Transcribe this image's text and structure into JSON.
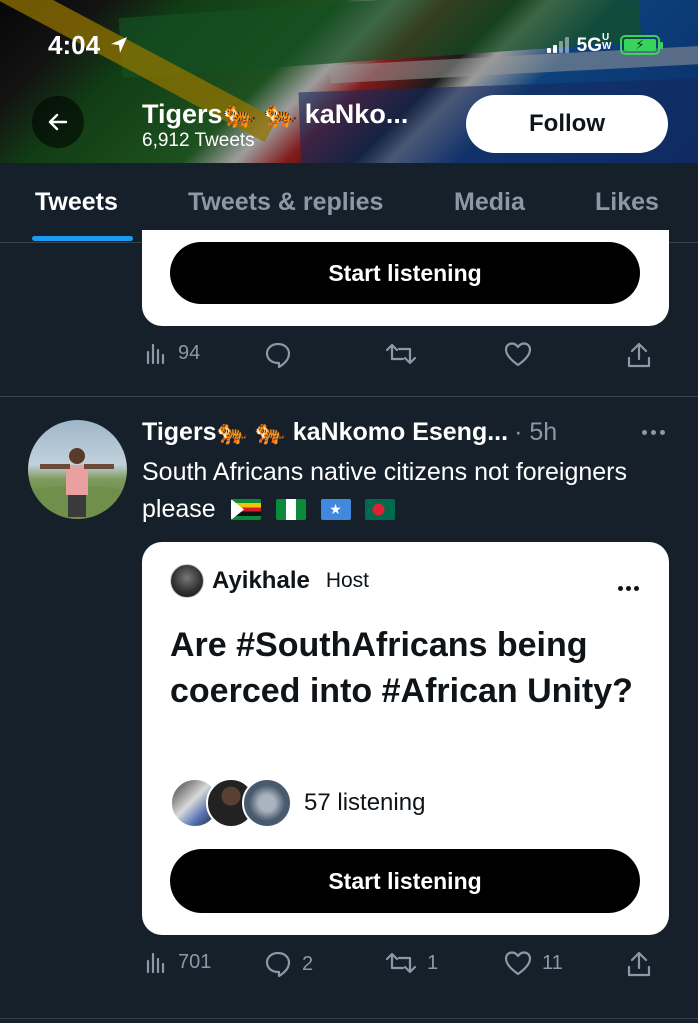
{
  "status_bar": {
    "time": "4:04",
    "network": "5G",
    "network_suffix": "UW"
  },
  "header": {
    "display_name": "Tigers🐅 🐅 kaNko...",
    "tweet_count": "6,912 Tweets",
    "follow_label": "Follow"
  },
  "tabs": [
    {
      "label": "Tweets",
      "active": true
    },
    {
      "label": "Tweets & replies",
      "active": false
    },
    {
      "label": "Media",
      "active": false
    },
    {
      "label": "Likes",
      "active": false
    }
  ],
  "tweet1": {
    "start_listening_label": "Start listening",
    "views": "94",
    "replies": "",
    "retweets": "",
    "likes": ""
  },
  "tweet2": {
    "author": "Tigers🐅 🐅 kaNkomo Eseng...",
    "time": "· 5h",
    "text": "South Africans native citizens not foreigners please",
    "flags": [
      "zimbabwe-flag",
      "nigeria-flag",
      "somalia-flag",
      "bangladesh-flag"
    ],
    "space": {
      "host_name": "Ayikhale",
      "host_tag": "Host",
      "title": "Are #SouthAfricans being coerced into #African Unity?",
      "listening": "57 listening",
      "start_listening_label": "Start listening"
    },
    "views": "701",
    "replies": "2",
    "retweets": "1",
    "likes": "11"
  },
  "colors": {
    "background": "#15202b",
    "accent": "#1d9bf0",
    "muted": "#8b98a5",
    "battery": "#36d45a"
  }
}
